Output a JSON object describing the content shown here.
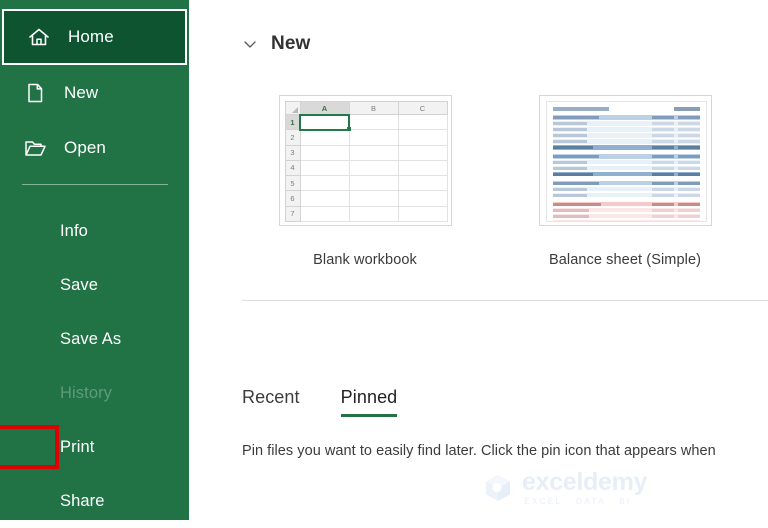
{
  "colors": {
    "sidebar_green": "#217346",
    "sidebar_selected_green": "#0e5431",
    "annotation_red": "#e00000",
    "tab_accent_green": "#217346",
    "cell_selection_green": "#21794a"
  },
  "sidebar": {
    "top_items": [
      {
        "label": "Home",
        "icon": "home-icon",
        "selected": true
      },
      {
        "label": "New",
        "icon": "new-document-icon",
        "selected": false
      },
      {
        "label": "Open",
        "icon": "open-folder-icon",
        "selected": false
      }
    ],
    "list_items": [
      {
        "label": "Info",
        "disabled": false,
        "annotated": false
      },
      {
        "label": "Save",
        "disabled": false,
        "annotated": false
      },
      {
        "label": "Save As",
        "disabled": false,
        "annotated": false
      },
      {
        "label": "History",
        "disabled": true,
        "annotated": false
      },
      {
        "label": "Print",
        "disabled": false,
        "annotated": true
      },
      {
        "label": "Share",
        "disabled": false,
        "annotated": false
      }
    ]
  },
  "main": {
    "new_section": {
      "title": "New",
      "collapse_icon": "chevron-down-icon",
      "templates": [
        {
          "label": "Blank workbook",
          "thumb_type": "blank-grid",
          "columns": [
            "A",
            "B",
            "C"
          ],
          "rows": [
            "1",
            "2",
            "3",
            "4",
            "5",
            "6",
            "7"
          ],
          "selected_cell": "A1"
        },
        {
          "label": "Balance sheet (Simple)",
          "thumb_type": "balance-sheet"
        }
      ]
    },
    "tabs": [
      {
        "label": "Recent",
        "active": false
      },
      {
        "label": "Pinned",
        "active": true
      }
    ],
    "hint": "Pin files you want to easily find later. Click the pin icon that appears when"
  },
  "watermark": {
    "name": "exceldemy",
    "tagline": "EXCEL · DATA · BI",
    "icon": "cube-logo-icon"
  }
}
